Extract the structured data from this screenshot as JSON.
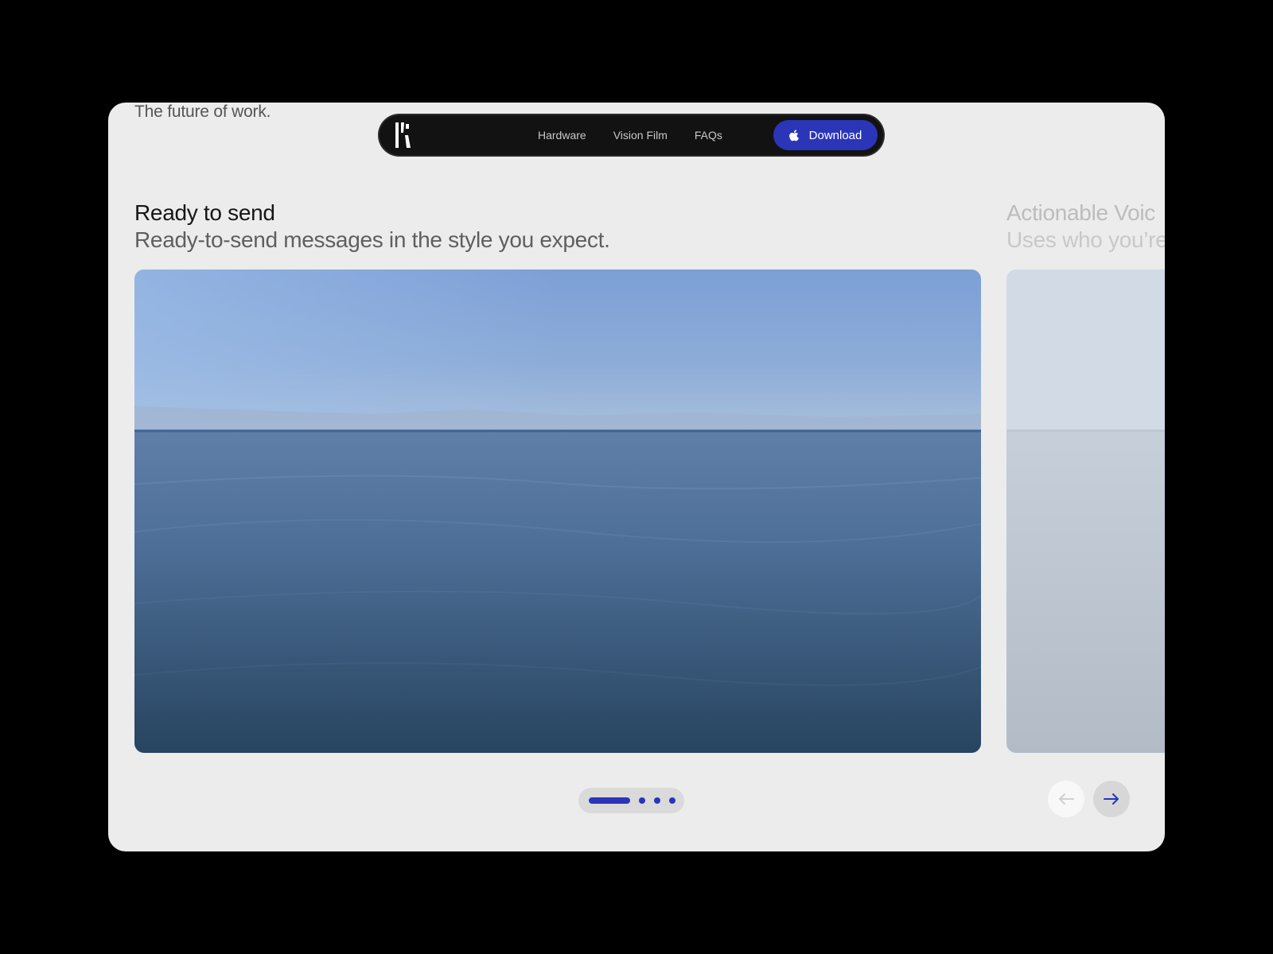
{
  "header": {
    "tagline": "The future of work."
  },
  "nav": {
    "logo": "logo-icon",
    "links": [
      "Hardware",
      "Vision Film",
      "FAQs"
    ],
    "download": {
      "label": "Download",
      "icon": "apple-icon"
    }
  },
  "slides": [
    {
      "title": "Ready to send",
      "subtitle": "Ready-to-send messages in the style you expect."
    },
    {
      "title": "Actionable Voic",
      "subtitle": "Uses who you’re"
    }
  ],
  "pagination": {
    "count": 4,
    "active_index": 0
  },
  "controls": {
    "prev_icon": "arrow-left-icon",
    "next_icon": "arrow-right-icon"
  },
  "colors": {
    "accent": "#2a35b8",
    "background": "#000000",
    "panel": "#ececec",
    "nav_bg": "#121212"
  }
}
